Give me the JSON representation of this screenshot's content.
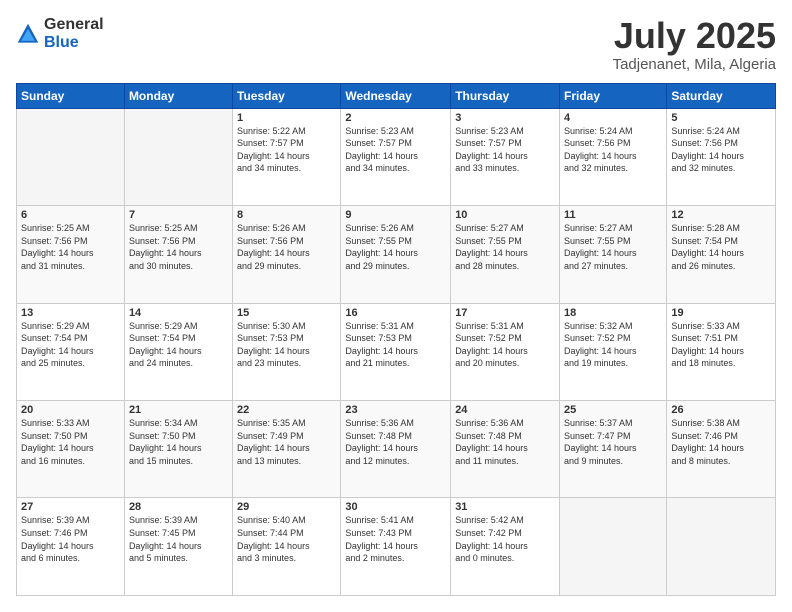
{
  "logo": {
    "general": "General",
    "blue": "Blue"
  },
  "title": "July 2025",
  "location": "Tadjenanet, Mila, Algeria",
  "weekdays": [
    "Sunday",
    "Monday",
    "Tuesday",
    "Wednesday",
    "Thursday",
    "Friday",
    "Saturday"
  ],
  "weeks": [
    [
      {
        "day": "",
        "info": ""
      },
      {
        "day": "",
        "info": ""
      },
      {
        "day": "1",
        "info": "Sunrise: 5:22 AM\nSunset: 7:57 PM\nDaylight: 14 hours\nand 34 minutes."
      },
      {
        "day": "2",
        "info": "Sunrise: 5:23 AM\nSunset: 7:57 PM\nDaylight: 14 hours\nand 34 minutes."
      },
      {
        "day": "3",
        "info": "Sunrise: 5:23 AM\nSunset: 7:57 PM\nDaylight: 14 hours\nand 33 minutes."
      },
      {
        "day": "4",
        "info": "Sunrise: 5:24 AM\nSunset: 7:56 PM\nDaylight: 14 hours\nand 32 minutes."
      },
      {
        "day": "5",
        "info": "Sunrise: 5:24 AM\nSunset: 7:56 PM\nDaylight: 14 hours\nand 32 minutes."
      }
    ],
    [
      {
        "day": "6",
        "info": "Sunrise: 5:25 AM\nSunset: 7:56 PM\nDaylight: 14 hours\nand 31 minutes."
      },
      {
        "day": "7",
        "info": "Sunrise: 5:25 AM\nSunset: 7:56 PM\nDaylight: 14 hours\nand 30 minutes."
      },
      {
        "day": "8",
        "info": "Sunrise: 5:26 AM\nSunset: 7:56 PM\nDaylight: 14 hours\nand 29 minutes."
      },
      {
        "day": "9",
        "info": "Sunrise: 5:26 AM\nSunset: 7:55 PM\nDaylight: 14 hours\nand 29 minutes."
      },
      {
        "day": "10",
        "info": "Sunrise: 5:27 AM\nSunset: 7:55 PM\nDaylight: 14 hours\nand 28 minutes."
      },
      {
        "day": "11",
        "info": "Sunrise: 5:27 AM\nSunset: 7:55 PM\nDaylight: 14 hours\nand 27 minutes."
      },
      {
        "day": "12",
        "info": "Sunrise: 5:28 AM\nSunset: 7:54 PM\nDaylight: 14 hours\nand 26 minutes."
      }
    ],
    [
      {
        "day": "13",
        "info": "Sunrise: 5:29 AM\nSunset: 7:54 PM\nDaylight: 14 hours\nand 25 minutes."
      },
      {
        "day": "14",
        "info": "Sunrise: 5:29 AM\nSunset: 7:54 PM\nDaylight: 14 hours\nand 24 minutes."
      },
      {
        "day": "15",
        "info": "Sunrise: 5:30 AM\nSunset: 7:53 PM\nDaylight: 14 hours\nand 23 minutes."
      },
      {
        "day": "16",
        "info": "Sunrise: 5:31 AM\nSunset: 7:53 PM\nDaylight: 14 hours\nand 21 minutes."
      },
      {
        "day": "17",
        "info": "Sunrise: 5:31 AM\nSunset: 7:52 PM\nDaylight: 14 hours\nand 20 minutes."
      },
      {
        "day": "18",
        "info": "Sunrise: 5:32 AM\nSunset: 7:52 PM\nDaylight: 14 hours\nand 19 minutes."
      },
      {
        "day": "19",
        "info": "Sunrise: 5:33 AM\nSunset: 7:51 PM\nDaylight: 14 hours\nand 18 minutes."
      }
    ],
    [
      {
        "day": "20",
        "info": "Sunrise: 5:33 AM\nSunset: 7:50 PM\nDaylight: 14 hours\nand 16 minutes."
      },
      {
        "day": "21",
        "info": "Sunrise: 5:34 AM\nSunset: 7:50 PM\nDaylight: 14 hours\nand 15 minutes."
      },
      {
        "day": "22",
        "info": "Sunrise: 5:35 AM\nSunset: 7:49 PM\nDaylight: 14 hours\nand 13 minutes."
      },
      {
        "day": "23",
        "info": "Sunrise: 5:36 AM\nSunset: 7:48 PM\nDaylight: 14 hours\nand 12 minutes."
      },
      {
        "day": "24",
        "info": "Sunrise: 5:36 AM\nSunset: 7:48 PM\nDaylight: 14 hours\nand 11 minutes."
      },
      {
        "day": "25",
        "info": "Sunrise: 5:37 AM\nSunset: 7:47 PM\nDaylight: 14 hours\nand 9 minutes."
      },
      {
        "day": "26",
        "info": "Sunrise: 5:38 AM\nSunset: 7:46 PM\nDaylight: 14 hours\nand 8 minutes."
      }
    ],
    [
      {
        "day": "27",
        "info": "Sunrise: 5:39 AM\nSunset: 7:46 PM\nDaylight: 14 hours\nand 6 minutes."
      },
      {
        "day": "28",
        "info": "Sunrise: 5:39 AM\nSunset: 7:45 PM\nDaylight: 14 hours\nand 5 minutes."
      },
      {
        "day": "29",
        "info": "Sunrise: 5:40 AM\nSunset: 7:44 PM\nDaylight: 14 hours\nand 3 minutes."
      },
      {
        "day": "30",
        "info": "Sunrise: 5:41 AM\nSunset: 7:43 PM\nDaylight: 14 hours\nand 2 minutes."
      },
      {
        "day": "31",
        "info": "Sunrise: 5:42 AM\nSunset: 7:42 PM\nDaylight: 14 hours\nand 0 minutes."
      },
      {
        "day": "",
        "info": ""
      },
      {
        "day": "",
        "info": ""
      }
    ]
  ]
}
